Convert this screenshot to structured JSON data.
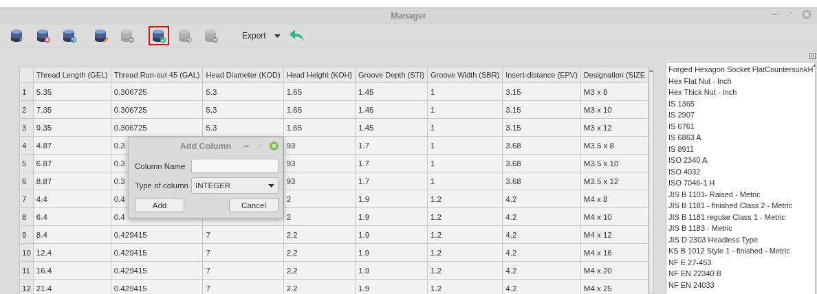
{
  "window": {
    "title": "Manager"
  },
  "toolbar": {
    "buttons": [
      {
        "disabled": false,
        "selected": false
      },
      {
        "disabled": false,
        "selected": false
      },
      {
        "disabled": false,
        "selected": false
      },
      {
        "disabled": false,
        "selected": false
      },
      {
        "disabled": true,
        "selected": false
      },
      {
        "disabled": false,
        "selected": true
      },
      {
        "disabled": true,
        "selected": false
      },
      {
        "disabled": true,
        "selected": false
      }
    ],
    "export": {
      "label": "Export"
    }
  },
  "table": {
    "columns": [
      "Thread Length (GEL)",
      "Thread Run-out 45 (GAL)",
      "Head Diameter (KOD)",
      "Head Height (KOH)",
      "Groove Depth (STI)",
      "Groove Width (SBR)",
      "Insert-distance (EPV)",
      "Designation (SIZE"
    ],
    "rows": [
      {
        "number": "1",
        "cells": [
          "5.35",
          "0.306725",
          "5.3",
          "1.65",
          "1.45",
          "1",
          "3.15",
          "M3 x 8"
        ]
      },
      {
        "number": "2",
        "cells": [
          "7.35",
          "0.306725",
          "5.3",
          "1.65",
          "1.45",
          "1",
          "3.15",
          "M3 x 10"
        ]
      },
      {
        "number": "3",
        "cells": [
          "9.35",
          "0.306725",
          "5.3",
          "1.65",
          "1.45",
          "1",
          "3.15",
          "M3 x 12"
        ]
      },
      {
        "number": "4",
        "cells": [
          "4.87",
          "0.3",
          null,
          "93",
          "1.7",
          "1",
          "3.68",
          "M3.5 x 8"
        ]
      },
      {
        "number": "5",
        "cells": [
          "6.87",
          "0.3",
          null,
          "93",
          "1.7",
          "1",
          "3.68",
          "M3.5 x 10"
        ]
      },
      {
        "number": "6",
        "cells": [
          "8.87",
          "0.3",
          null,
          "93",
          "1.7",
          "1",
          "3.68",
          "M3.5 x 12"
        ]
      },
      {
        "number": "7",
        "cells": [
          "4.4",
          "0.4",
          null,
          "2",
          "1.9",
          "1.2",
          "4.2",
          "M4 x 8"
        ]
      },
      {
        "number": "8",
        "cells": [
          "6.4",
          "0.4",
          null,
          "2",
          "1.9",
          "1.2",
          "4.2",
          "M4 x 10"
        ]
      },
      {
        "number": "9",
        "cells": [
          "8.4",
          "0.429415",
          "7",
          "2.2",
          "1.9",
          "1.2",
          "4.2",
          "M4 x 12"
        ]
      },
      {
        "number": "10",
        "cells": [
          "12.4",
          "0.429415",
          "7",
          "2.2",
          "1.9",
          "1.2",
          "4.2",
          "M4 x 16"
        ]
      },
      {
        "number": "11",
        "cells": [
          "16.4",
          "0.429415",
          "7",
          "2.2",
          "1.9",
          "1.2",
          "4.2",
          "M4 x 20"
        ]
      },
      {
        "number": "12",
        "cells": [
          "21.4",
          "0.429415",
          "7",
          "2.2",
          "1.9",
          "1.2",
          "4.2",
          "M4 x 25"
        ]
      }
    ]
  },
  "side_list": {
    "items": [
      "Forged Hexagon Socket FlatCountersunkH",
      "Hex Flat Nut - Inch",
      "Hex Thick Nut - Inch",
      "IS 1365",
      "IS 2907",
      "IS 6761",
      "IS 6863 A",
      "IS 8911",
      "ISO 2340 A",
      "ISO 4032",
      "ISO 7046-1 H",
      "JIS B 1101- Raised - Metric",
      "JIS B 1181 - finished Class 2 - Metric",
      "JIS B 1181 regular Class 1 - Metric",
      "JIS B 1183 - Metric",
      "JIS D 2303 Headless Type",
      "KS B 1012 Style 1 - finished - Metric",
      "NF E 27-453",
      "NF EN 22340 B",
      "NF EN 24033"
    ]
  },
  "dialog": {
    "title": "Add Column",
    "name_label": "Column Name",
    "type_label": "Type of column",
    "type_value": "INTEGER",
    "buttons": [
      "Add",
      "Cancel"
    ]
  }
}
